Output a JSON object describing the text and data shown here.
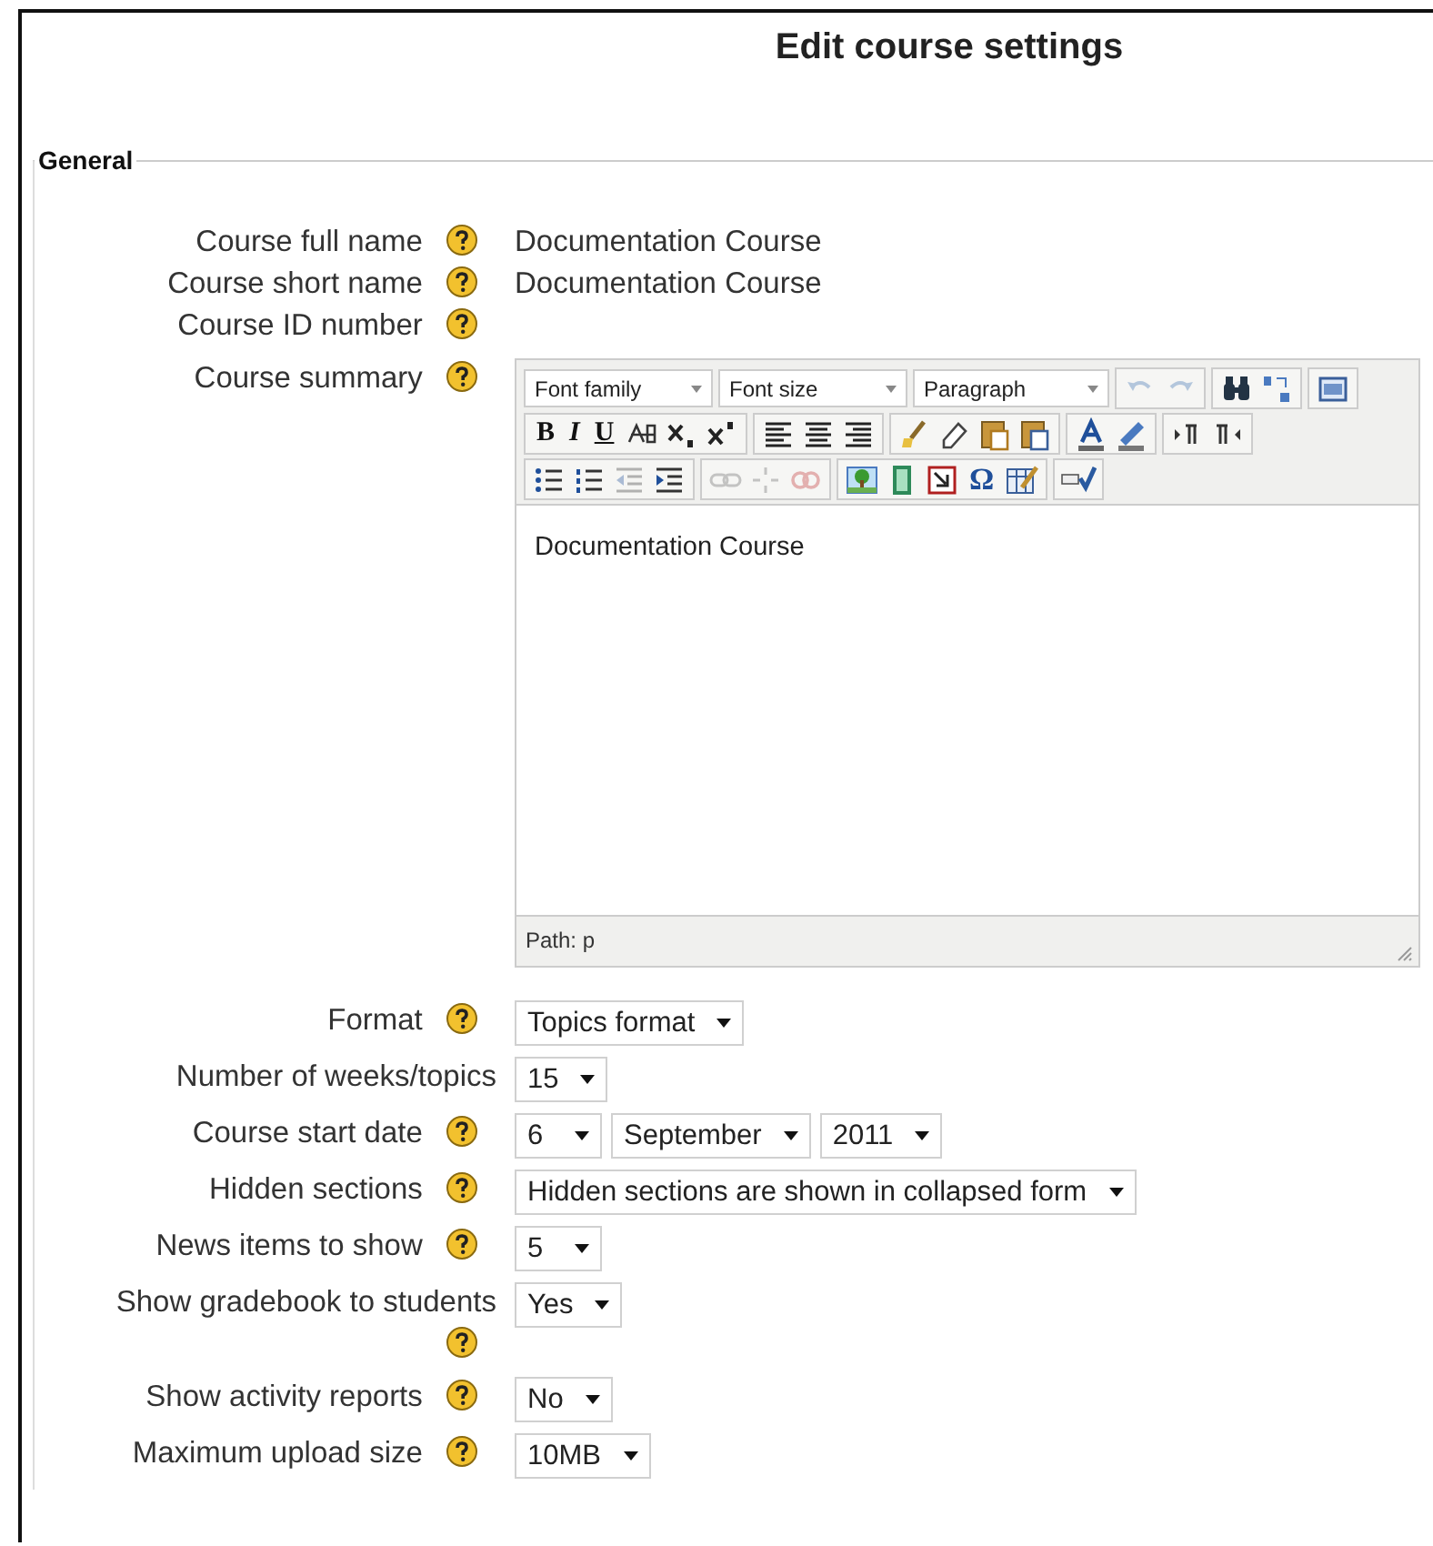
{
  "title": "Edit course settings",
  "section": {
    "legend": "General"
  },
  "fields": [
    {
      "label": "Course full name",
      "help": true,
      "kind": "text",
      "value": "Documentation Course"
    },
    {
      "label": "Course short name",
      "help": true,
      "kind": "text",
      "value": "Documentation Course"
    },
    {
      "label": "Course ID number",
      "help": true,
      "kind": "none"
    },
    {
      "label": "Course summary",
      "help": true,
      "kind": "editor"
    },
    {
      "label": "Format",
      "help": true,
      "kind": "select",
      "selects": [
        {
          "value": "Topics format"
        }
      ]
    },
    {
      "label": "Number of weeks/topics",
      "help": false,
      "kind": "select",
      "selects": [
        {
          "value": "15"
        }
      ]
    },
    {
      "label": "Course start date",
      "help": true,
      "kind": "select",
      "selects": [
        {
          "value": "6"
        },
        {
          "value": "September"
        },
        {
          "value": "2011"
        }
      ]
    },
    {
      "label": "Hidden sections",
      "help": true,
      "kind": "select",
      "selects": [
        {
          "value": "Hidden sections are shown in collapsed form"
        }
      ]
    },
    {
      "label": "News items to show",
      "help": true,
      "kind": "select",
      "selects": [
        {
          "value": "5"
        }
      ]
    },
    {
      "label": "Show gradebook to students",
      "help": true,
      "kind": "select",
      "selects": [
        {
          "value": "Yes"
        }
      ]
    },
    {
      "label": "Show activity reports",
      "help": true,
      "kind": "select",
      "selects": [
        {
          "value": "No"
        }
      ]
    },
    {
      "label": "Maximum upload size",
      "help": true,
      "kind": "select",
      "selects": [
        {
          "value": "10MB"
        }
      ]
    }
  ],
  "editor": {
    "dropdowns": [
      {
        "label": "Font family"
      },
      {
        "label": "Font size"
      },
      {
        "label": "Paragraph"
      }
    ],
    "rows": [
      [
        [
          {
            "kind": "undo",
            "disabled": true
          },
          {
            "kind": "redo",
            "disabled": true
          }
        ],
        [
          {
            "kind": "find",
            "disabled": false
          },
          {
            "kind": "replace",
            "disabled": false
          }
        ],
        [
          {
            "kind": "fullscreen",
            "disabled": false
          }
        ]
      ],
      [
        [
          {
            "kind": "bold",
            "glyph": "B",
            "disabled": false
          },
          {
            "kind": "italic",
            "glyph": "I",
            "disabled": false
          },
          {
            "kind": "underline",
            "glyph": "U",
            "disabled": false
          },
          {
            "kind": "strike",
            "disabled": false
          },
          {
            "kind": "sub",
            "disabled": false
          },
          {
            "kind": "sup",
            "disabled": false
          }
        ],
        [
          {
            "kind": "align-left",
            "disabled": false
          },
          {
            "kind": "align-center",
            "disabled": false
          },
          {
            "kind": "align-right",
            "disabled": false
          }
        ],
        [
          {
            "kind": "cleanup",
            "disabled": false
          },
          {
            "kind": "eraser",
            "disabled": false
          },
          {
            "kind": "paste-text",
            "disabled": false
          },
          {
            "kind": "paste-word",
            "disabled": false
          }
        ],
        [
          {
            "kind": "text-color",
            "disabled": false
          },
          {
            "kind": "highlight",
            "disabled": false
          }
        ],
        [
          {
            "kind": "ltr",
            "disabled": false
          },
          {
            "kind": "rtl",
            "disabled": false
          }
        ]
      ],
      [
        [
          {
            "kind": "bullets",
            "disabled": false
          },
          {
            "kind": "numbers",
            "disabled": false
          },
          {
            "kind": "outdent",
            "disabled": true
          },
          {
            "kind": "indent",
            "disabled": false
          }
        ],
        [
          {
            "kind": "link",
            "disabled": true
          },
          {
            "kind": "unlink",
            "disabled": true
          },
          {
            "kind": "anchor",
            "disabled": true
          }
        ],
        [
          {
            "kind": "image",
            "disabled": false
          },
          {
            "kind": "media",
            "disabled": false
          },
          {
            "kind": "embed",
            "disabled": false
          },
          {
            "kind": "charmap",
            "glyph": "Ω",
            "disabled": false
          },
          {
            "kind": "table",
            "disabled": false
          }
        ],
        [
          {
            "kind": "spellcheck",
            "disabled": false
          }
        ]
      ]
    ],
    "content": "Documentation Course",
    "path": "Path: p"
  }
}
